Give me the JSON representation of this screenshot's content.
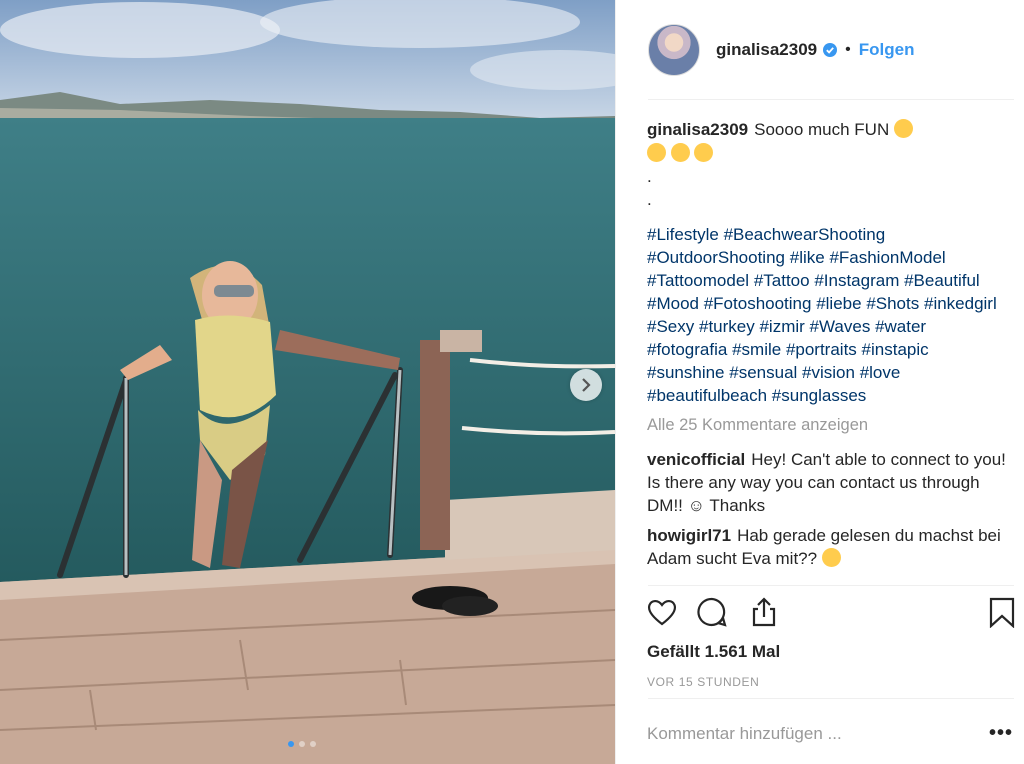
{
  "post": {
    "username": "ginalisa2309",
    "follow_label": "Folgen",
    "separator": "•",
    "caption_text": "Soooo much FUN",
    "caption_dot1": ".",
    "caption_dot2": ".",
    "hashtags": [
      "#Lifestyle",
      "#BeachwearShooting",
      "#OutdoorShooting",
      "#like",
      "#FashionModel",
      "#Tattoomodel",
      "#Tattoo",
      "#Instagram",
      "#Beautiful",
      "#Mood",
      "#Fotoshooting",
      "#liebe",
      "#Shots",
      "#inkedgirl",
      "#Sexy",
      "#turkey",
      "#izmir",
      "#Waves",
      "#water",
      "#fotografia",
      "#smile",
      "#portraits",
      "#instapic",
      "#sunshine",
      "#sensual",
      "#vision",
      "#love",
      "#beautifulbeach",
      "#sunglasses"
    ],
    "load_more": "Alle 25 Kommentare anzeigen",
    "comments": [
      {
        "user": "venicofficial",
        "text": "Hey! Can't able to connect to you! Is there any way you can contact us through DM!! ☺ Thanks"
      },
      {
        "user": "howigirl71",
        "text": "Hab gerade gelesen du machst bei Adam sucht Eva mit??"
      }
    ],
    "likes": "Gefällt 1.561 Mal",
    "time": "VOR 15 STUNDEN",
    "comment_placeholder": "Kommentar hinzufügen ...",
    "more_label": "•••"
  },
  "carousel": {
    "count": 3,
    "active_index": 0
  },
  "icons": [
    "heart-icon",
    "comment-icon",
    "share-icon",
    "bookmark-icon",
    "chevron-right-icon",
    "verified-icon"
  ],
  "colors": {
    "link": "#003569",
    "accent": "#3897f0",
    "muted": "#999999",
    "text": "#262626"
  }
}
